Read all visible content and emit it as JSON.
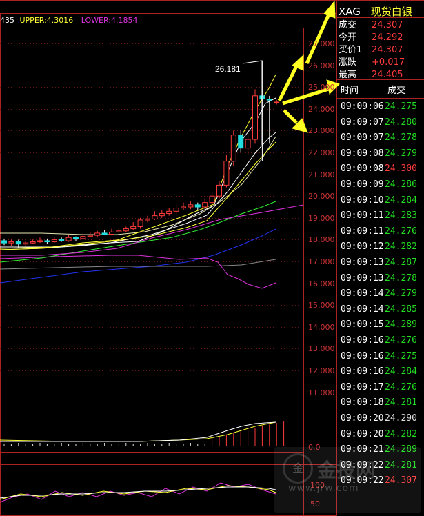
{
  "indicator": {
    "prefix": "435",
    "upper_label": "UPPER:4.3016",
    "lower_label": "LOWER:4.1854"
  },
  "annotation": {
    "peak_value": "26.181"
  },
  "price_axis": {
    "labels": [
      "27.000",
      "26.000",
      "25.000",
      "24.000",
      "23.000",
      "22.000",
      "21.000",
      "20.000",
      "19.000",
      "18.000",
      "17.000",
      "16.000",
      "15.000",
      "14.000",
      "13.000",
      "12.000",
      "11.000"
    ],
    "min": 11,
    "max": 27
  },
  "volume_axis": {
    "labels": [
      "0.0"
    ]
  },
  "osc_axis": {
    "labels": [
      "100",
      "50"
    ]
  },
  "quote_panel": {
    "symbol": "XAG",
    "name": "现货白银",
    "rows": [
      {
        "key": "成交",
        "value": "24.307"
      },
      {
        "key": "今开",
        "value": "24.292"
      },
      {
        "key": "买价1",
        "value": "24.307"
      },
      {
        "key": "涨跌",
        "value": "+0.017"
      },
      {
        "key": "最高",
        "value": "24.405"
      }
    ],
    "tick_header": {
      "time": "时间",
      "price": "成交"
    },
    "ticks": [
      {
        "time": "09:09:06",
        "price": "24.275",
        "color": "#22dd22"
      },
      {
        "time": "09:09:07",
        "price": "24.280",
        "color": "#22dd22"
      },
      {
        "time": "09:09:07",
        "price": "24.278",
        "color": "#22dd22"
      },
      {
        "time": "09:09:08",
        "price": "24.279",
        "color": "#22dd22"
      },
      {
        "time": "09:09:08",
        "price": "24.300",
        "color": "#ff3b3b"
      },
      {
        "time": "09:09:09",
        "price": "24.286",
        "color": "#22dd22"
      },
      {
        "time": "09:09:10",
        "price": "24.284",
        "color": "#22dd22"
      },
      {
        "time": "09:09:11",
        "price": "24.283",
        "color": "#22dd22"
      },
      {
        "time": "09:09:11",
        "price": "24.276",
        "color": "#22dd22"
      },
      {
        "time": "09:09:12",
        "price": "24.282",
        "color": "#22dd22"
      },
      {
        "time": "09:09:13",
        "price": "24.287",
        "color": "#22dd22"
      },
      {
        "time": "09:09:13",
        "price": "24.278",
        "color": "#22dd22"
      },
      {
        "time": "09:09:14",
        "price": "24.279",
        "color": "#22dd22"
      },
      {
        "time": "09:09:14",
        "price": "24.285",
        "color": "#22dd22"
      },
      {
        "time": "09:09:15",
        "price": "24.289",
        "color": "#22dd22"
      },
      {
        "time": "09:09:16",
        "price": "24.276",
        "color": "#22dd22"
      },
      {
        "time": "09:09:16",
        "price": "24.275",
        "color": "#22dd22"
      },
      {
        "time": "09:09:16",
        "price": "24.284",
        "color": "#22dd22"
      },
      {
        "time": "09:09:17",
        "price": "24.276",
        "color": "#22dd22"
      },
      {
        "time": "09:09:18",
        "price": "24.281",
        "color": "#22dd22"
      },
      {
        "time": "09:09:20",
        "price": "24.290",
        "color": "#dddddd"
      },
      {
        "time": "09:09:20",
        "price": "24.282",
        "color": "#22dd22"
      },
      {
        "time": "09:09:21",
        "price": "24.289",
        "color": "#22dd22"
      },
      {
        "time": "09:09:22",
        "price": "24.281",
        "color": "#22dd22"
      },
      {
        "time": "09:09:22",
        "price": "24.307",
        "color": "#ff3b3b"
      }
    ]
  },
  "watermark": {
    "brand": "金投网",
    "url": "www.jrw.com"
  },
  "colors": {
    "grid": "#aa2222",
    "up": "#ff3b3b",
    "down": "#22dddd",
    "accent_yellow": "#ffff33",
    "magenta": "#dd33dd",
    "blue": "#2233ee"
  }
}
